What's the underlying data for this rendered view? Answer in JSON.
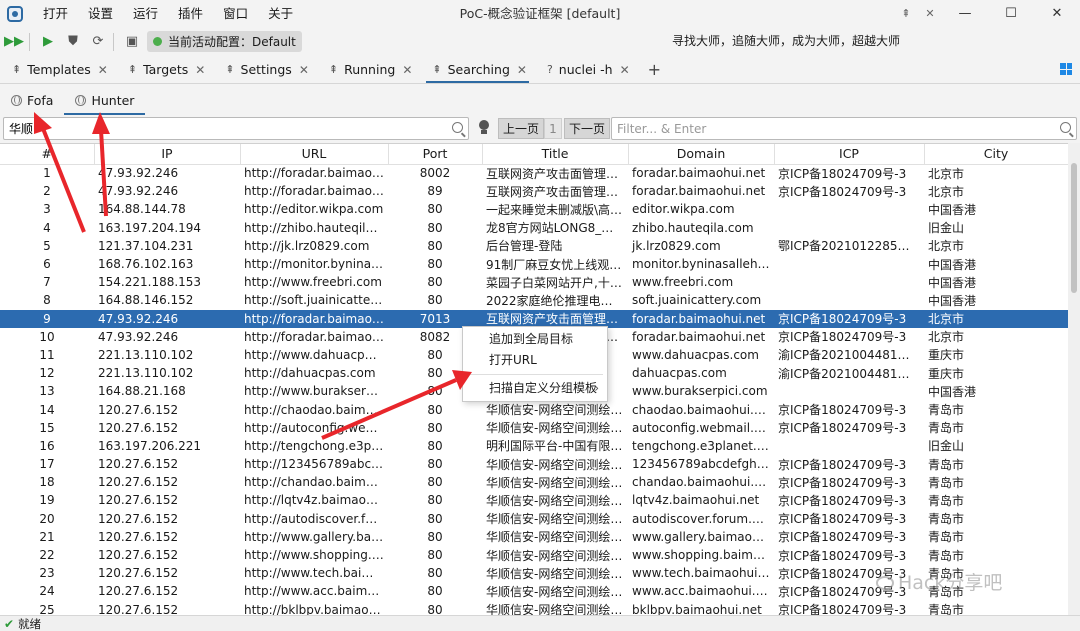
{
  "app": {
    "title": "PoC-概念验证框架 [default]",
    "menu": [
      "打开",
      "设置",
      "运行",
      "插件",
      "窗口",
      "关于"
    ],
    "pin_glyph": "⇞"
  },
  "toolbar": {
    "active_config_label": "当前活动配置：Default",
    "slogan": "寻找大师，追随大师，成为大师，超越大师"
  },
  "tabs": [
    {
      "label": "Templates",
      "icon": "pin-icon"
    },
    {
      "label": "Targets",
      "icon": "pin-icon"
    },
    {
      "label": "Settings",
      "icon": "pin-icon"
    },
    {
      "label": "Running",
      "icon": "pin-icon"
    },
    {
      "label": "Searching",
      "icon": "pin-icon",
      "active": true
    },
    {
      "label": "nuclei -h",
      "icon": "help-icon",
      "glyph": "?"
    }
  ],
  "subtabs": [
    {
      "label": "Fofa",
      "icon": "globe-icon"
    },
    {
      "label": "Hunter",
      "icon": "globe-icon",
      "active": true
    }
  ],
  "search": {
    "value": "华顺",
    "prev_label": "上一页",
    "page": "1",
    "next_label": "下一页",
    "filter_placeholder": "Filter... & Enter"
  },
  "table": {
    "columns": [
      "#",
      "IP",
      "URL",
      "Port",
      "Title",
      "Domain",
      "ICP",
      "City"
    ],
    "selected_row": 9,
    "rows": [
      [
        "1",
        "47.93.92.246",
        "http://foradar.baimaohui....",
        "8002",
        "互联网资产攻击面管理平台",
        "foradar.baimaohui.net",
        "京ICP备18024709号-3",
        "北京市"
      ],
      [
        "2",
        "47.93.92.246",
        "http://foradar.baimaohui....",
        "89",
        "互联网资产攻击面管理平台",
        "foradar.baimaohui.net",
        "京ICP备18024709号-3",
        "北京市"
      ],
      [
        "3",
        "164.88.144.78",
        "http://editor.wikpa.com",
        "80",
        "一起来睡觉未删减版\\高清...",
        "editor.wikpa.com",
        "",
        "中国香港"
      ],
      [
        "4",
        "163.197.204.194",
        "http://zhibo.hauteqila.com",
        "80",
        "龙8官方网站LONG8_百度...",
        "zhibo.hauteqila.com",
        "",
        "旧金山"
      ],
      [
        "5",
        "121.37.104.231",
        "http://jk.lrz0829.com",
        "80",
        "后台管理-登陆",
        "jk.lrz0829.com",
        "鄂ICP备2021012285号-1",
        "北京市"
      ],
      [
        "6",
        "168.76.102.163",
        "http://monitor.byninasall...",
        "80",
        "91制厂麻豆女忧上线观~高...",
        "monitor.byninasalleh.com",
        "",
        "中国香港"
      ],
      [
        "7",
        "154.221.188.153",
        "http://www.freebri.com",
        "80",
        "菜园子白菜网站开户,十大网...",
        "www.freebri.com",
        "",
        "中国香港"
      ],
      [
        "8",
        "164.88.146.152",
        "http://soft.juainicattery.c...",
        "80",
        "2022家庭绝伦推理电影202...",
        "soft.juainicattery.com",
        "",
        "中国香港"
      ],
      [
        "9",
        "47.93.92.246",
        "http://foradar.baimaohui....",
        "7013",
        "互联网资产攻击面管理平台",
        "foradar.baimaohui.net",
        "京ICP备18024709号-3",
        "北京市"
      ],
      [
        "10",
        "47.93.92.246",
        "http://foradar.baimaohui....",
        "8082",
        "互联网资产攻击面管理平台",
        "foradar.baimaohui.net",
        "京ICP备18024709号-3",
        "北京市"
      ],
      [
        "11",
        "221.13.110.102",
        "http://www.dahuacpas.co...",
        "80",
        "",
        "www.dahuacpas.com",
        "渝ICP备2021004481号-1",
        "重庆市"
      ],
      [
        "12",
        "221.13.110.102",
        "http://dahuacpas.com",
        "80",
        "",
        "dahuacpas.com",
        "渝ICP备2021004481号-1",
        "重庆市"
      ],
      [
        "13",
        "164.88.21.168",
        "http://www.burakserpici.com",
        "80",
        "度...",
        "www.burakserpici.com",
        "",
        "中国香港"
      ],
      [
        "14",
        "120.27.6.152",
        "http://chaodao.baimaohui...",
        "80",
        "华顺信安-网络空间测绘的...",
        "chaodao.baimaohui.net",
        "京ICP备18024709号-3",
        "青岛市"
      ],
      [
        "15",
        "120.27.6.152",
        "http://autoconfig.webmai...",
        "80",
        "华顺信安-网络空间测绘的...",
        "autoconfig.webmail.baim...",
        "京ICP备18024709号-3",
        "青岛市"
      ],
      [
        "16",
        "163.197.206.221",
        "http://tengchong.e3plan...",
        "80",
        "明利国际平台-中国有限公...",
        "tengchong.e3planet.com",
        "",
        "旧金山"
      ],
      [
        "17",
        "120.27.6.152",
        "http://123456789abcdef...",
        "80",
        "华顺信安-网络空间测绘的...",
        "123456789abcdefghijklm...",
        "京ICP备18024709号-3",
        "青岛市"
      ],
      [
        "18",
        "120.27.6.152",
        "http://chandao.baimaohu...",
        "80",
        "华顺信安-网络空间测绘的...",
        "chandao.baimaohui.net",
        "京ICP备18024709号-3",
        "青岛市"
      ],
      [
        "19",
        "120.27.6.152",
        "http://lqtv4z.baimaohui.n...",
        "80",
        "华顺信安-网络空间测绘的...",
        "lqtv4z.baimaohui.net",
        "京ICP备18024709号-3",
        "青岛市"
      ],
      [
        "20",
        "120.27.6.152",
        "http://autodiscover.forum...",
        "80",
        "华顺信安-网络空间测绘的...",
        "autodiscover.forum.baim...",
        "京ICP备18024709号-3",
        "青岛市"
      ],
      [
        "21",
        "120.27.6.152",
        "http://www.gallery.baima...",
        "80",
        "华顺信安-网络空间测绘的...",
        "www.gallery.baimaohui.net",
        "京ICP备18024709号-3",
        "青岛市"
      ],
      [
        "22",
        "120.27.6.152",
        "http://www.shopping.bai...",
        "80",
        "华顺信安-网络空间测绘的...",
        "www.shopping.baimaohui...",
        "京ICP备18024709号-3",
        "青岛市"
      ],
      [
        "23",
        "120.27.6.152",
        "http://www.tech.baimaoh...",
        "80",
        "华顺信安-网络空间测绘的...",
        "www.tech.baimaohui.net",
        "京ICP备18024709号-3",
        "青岛市"
      ],
      [
        "24",
        "120.27.6.152",
        "http://www.acc.baimaohui...",
        "80",
        "华顺信安-网络空间测绘的...",
        "www.acc.baimaohui.net",
        "京ICP备18024709号-3",
        "青岛市"
      ],
      [
        "25",
        "120.27.6.152",
        "http://bklbpv.baimaohui.n...",
        "80",
        "华顺信安-网络空间测绘的...",
        "bklbpv.baimaohui.net",
        "京ICP备18024709号-3",
        "青岛市"
      ]
    ]
  },
  "context_menu": {
    "items": [
      "追加到全局目标",
      "打开URL",
      "扫描自定义分组模板"
    ]
  },
  "status": {
    "text": "就绪"
  },
  "watermark": "Hack分享吧",
  "colors": {
    "accent": "#2d6aa3",
    "selection": "#2c6bb0",
    "annotation_arrow": "#e8262b"
  }
}
